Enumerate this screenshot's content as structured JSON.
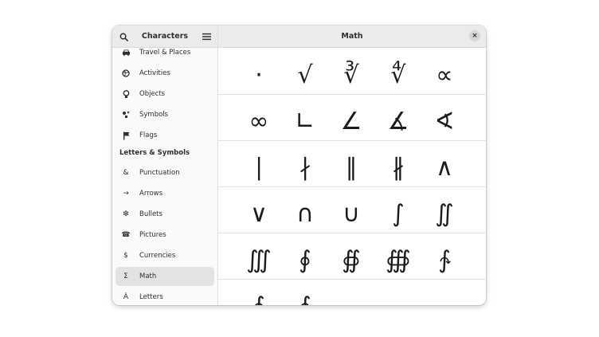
{
  "sidebar": {
    "title": "Characters",
    "categories_top": [
      {
        "label": "Travel & Places",
        "icon": "car-icon"
      },
      {
        "label": "Activities",
        "icon": "ball-icon"
      },
      {
        "label": "Objects",
        "icon": "lightbulb-icon"
      },
      {
        "label": "Symbols",
        "icon": "shapes-icon"
      },
      {
        "label": "Flags",
        "icon": "flag-icon"
      }
    ],
    "section_heading": "Letters & Symbols",
    "categories_bottom": [
      {
        "label": "Punctuation",
        "icon": "ampersand-icon",
        "glyph": "&"
      },
      {
        "label": "Arrows",
        "icon": "arrow-right-icon",
        "glyph": "→"
      },
      {
        "label": "Bullets",
        "icon": "bullet-icon",
        "glyph": "❇"
      },
      {
        "label": "Pictures",
        "icon": "telephone-icon",
        "glyph": "☎"
      },
      {
        "label": "Currencies",
        "icon": "dollar-icon",
        "glyph": "$"
      },
      {
        "label": "Math",
        "icon": "sigma-icon",
        "glyph": "Σ",
        "selected": true
      },
      {
        "label": "Letters",
        "icon": "letter-a-icon",
        "glyph": "Ȧ"
      }
    ]
  },
  "content": {
    "title": "Math",
    "close_glyph": "×"
  },
  "glyphs": [
    [
      "·",
      "√",
      "∛",
      "∜",
      "∝"
    ],
    [
      "∞",
      "∟",
      "∠",
      "∡",
      "∢"
    ],
    [
      "∣",
      "∤",
      "∥",
      "∦",
      "∧"
    ],
    [
      "∨",
      "∩",
      "∪",
      "∫",
      "∬"
    ],
    [
      "∭",
      "∮",
      "∯",
      "∰",
      "∱"
    ],
    [
      "∲",
      "∳"
    ]
  ]
}
